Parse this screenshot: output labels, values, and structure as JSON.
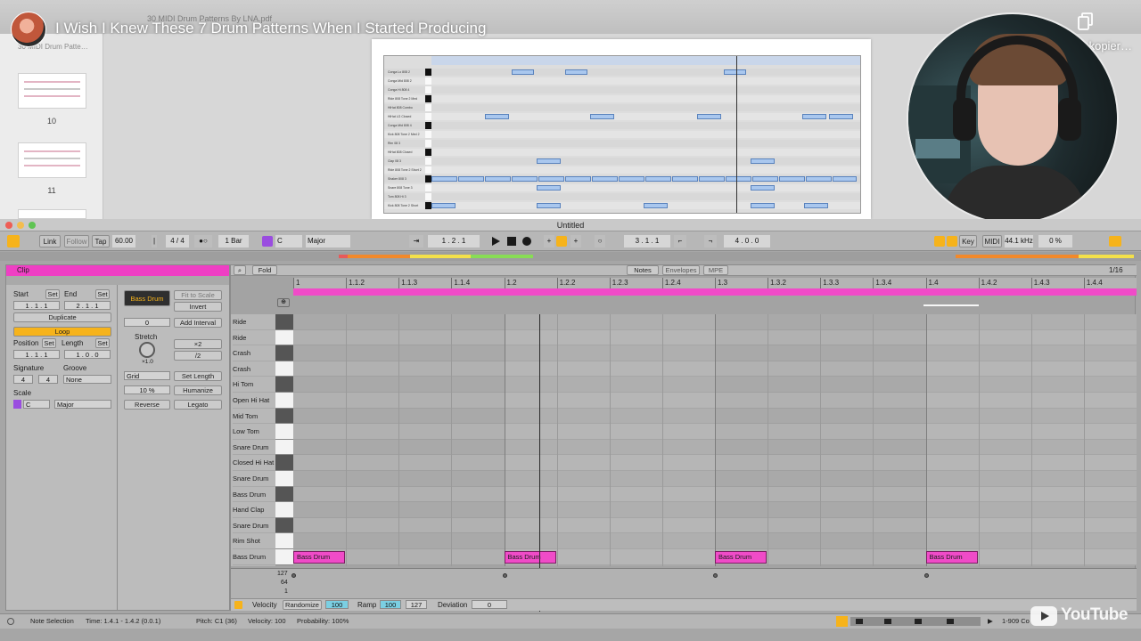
{
  "youtube": {
    "video_title": "I Wish I Knew These 7 Drum Patterns When I Started Producing",
    "copy_link_label": "Link kopier…",
    "logo_text": "YouTube"
  },
  "pdf_viewer": {
    "document_title": "30 MIDI Drum Patterns By LNA.pdf",
    "sidebar_doc_label": "30 MIDI Drum Patte…",
    "thumbnails": [
      {
        "number": "10"
      },
      {
        "number": "11"
      }
    ],
    "page_rows": [
      "Conga Lo 808 2",
      "Conga Mid 808 2",
      "Conga Hi 808 4",
      "Ride 808 Tone 2 Med",
      "HiHat 808 Combo",
      "HiHat LG Closed",
      "Conga Mid 808 4",
      "Kick 808 Tone 2 Med 2",
      "Rim 08 3",
      "HiHat 808 Closed",
      "Clap 08 3",
      "Ride 808 Tone 2 Short 2",
      "Shaker 808 3",
      "Snare 808 Tone 3",
      "Tom 808 Hi 3",
      "Kick 808 Tone 2 Short"
    ]
  },
  "ableton": {
    "window_title": "Untitled",
    "transport": {
      "link": "Link",
      "follow": "Follow",
      "tap": "Tap",
      "tempo": "60.00",
      "time_sig": "4 / 4",
      "quantize": "1 Bar",
      "key_root": "C",
      "key_scale": "Major",
      "arrangement_position": "1 .   2 .   1",
      "loop_start": "3 .   1 .   1",
      "loop_length": "4 .   0 .   0",
      "key_label": "Key",
      "midi_label": "MIDI",
      "sample_rate": "44.1 kHz",
      "cpu": "0 %"
    },
    "clip_panel": {
      "header": "Clip",
      "start_label": "Start",
      "end_label": "End",
      "set_label": "Set",
      "start_value": "1 .   1 .   1",
      "end_value": "2 .   1 .   1",
      "duplicate": "Duplicate",
      "loop": "Loop",
      "position_label": "Position",
      "length_label": "Length",
      "position_value": "1 .   1 .   1",
      "length_value": "1 .   0 .   0",
      "signature_label": "Signature",
      "groove_label": "Groove",
      "sig_num": "4",
      "sig_den": "4",
      "groove_value": "None",
      "scale_label": "Scale",
      "scale_root": "C",
      "scale_name": "Major",
      "instrument": "Bass Drum",
      "fit_to_scale": "Fit to Scale",
      "invert": "Invert",
      "transpose": "0",
      "add_interval": "Add Interval",
      "stretch_label": "Stretch",
      "stretch_value": "×1.0",
      "times2": "×2",
      "div2": "/2",
      "grid_label": "Grid",
      "set_length": "Set Length",
      "humanize_amount": "10 %",
      "humanize": "Humanize",
      "reverse": "Reverse",
      "legato": "Legato"
    },
    "midi_editor": {
      "fold": "Fold",
      "tabs": [
        "Notes",
        "Envelopes",
        "MPE"
      ],
      "grid_resolution": "1/16",
      "ruler": [
        "1",
        "1.1.2",
        "1.1.3",
        "1.1.4",
        "1.2",
        "1.2.2",
        "1.2.3",
        "1.2.4",
        "1.3",
        "1.3.2",
        "1.3.3",
        "1.3.4",
        "1.4",
        "1.4.2",
        "1.4.3",
        "1.4.4"
      ],
      "lanes": [
        "Ride",
        "Ride",
        "Crash",
        "Crash",
        "Hi Tom",
        "Open Hi Hat",
        "Mid Tom",
        "Low Tom",
        "Snare Drum",
        "Closed Hi Hat",
        "Snare Drum",
        "Bass Drum",
        "Hand Clap",
        "Snare Drum",
        "Rim Shot",
        "Bass Drum"
      ],
      "notes": [
        {
          "label": "Bass Drum",
          "beat": 0
        },
        {
          "label": "Bass Drum",
          "beat": 1
        },
        {
          "label": "Bass Drum",
          "beat": 2
        },
        {
          "label": "Bass Drum",
          "beat": 3
        }
      ],
      "velocity_axis": [
        "127",
        "64",
        "1"
      ],
      "velocity_bar": {
        "velocity": "Velocity",
        "randomize": "Randomize",
        "randomize_value": "100",
        "ramp": "Ramp",
        "ramp_start": "100",
        "ramp_end": "127",
        "deviation": "Deviation",
        "deviation_value": "0"
      }
    },
    "status_bar": {
      "selection": "Note Selection",
      "time": "Time: 1.4.1 - 1.4.2 (0.0.1)",
      "pitch": "Pitch: C1 (36)",
      "velocity": "Velocity: 100",
      "probability": "Probability: 100%",
      "track": "1-909 Co"
    }
  },
  "colors": {
    "clip_pink": "#f04bc8",
    "ableton_gray": "#a6a6a6",
    "pdf_note_blue": "#a9c7ee"
  }
}
